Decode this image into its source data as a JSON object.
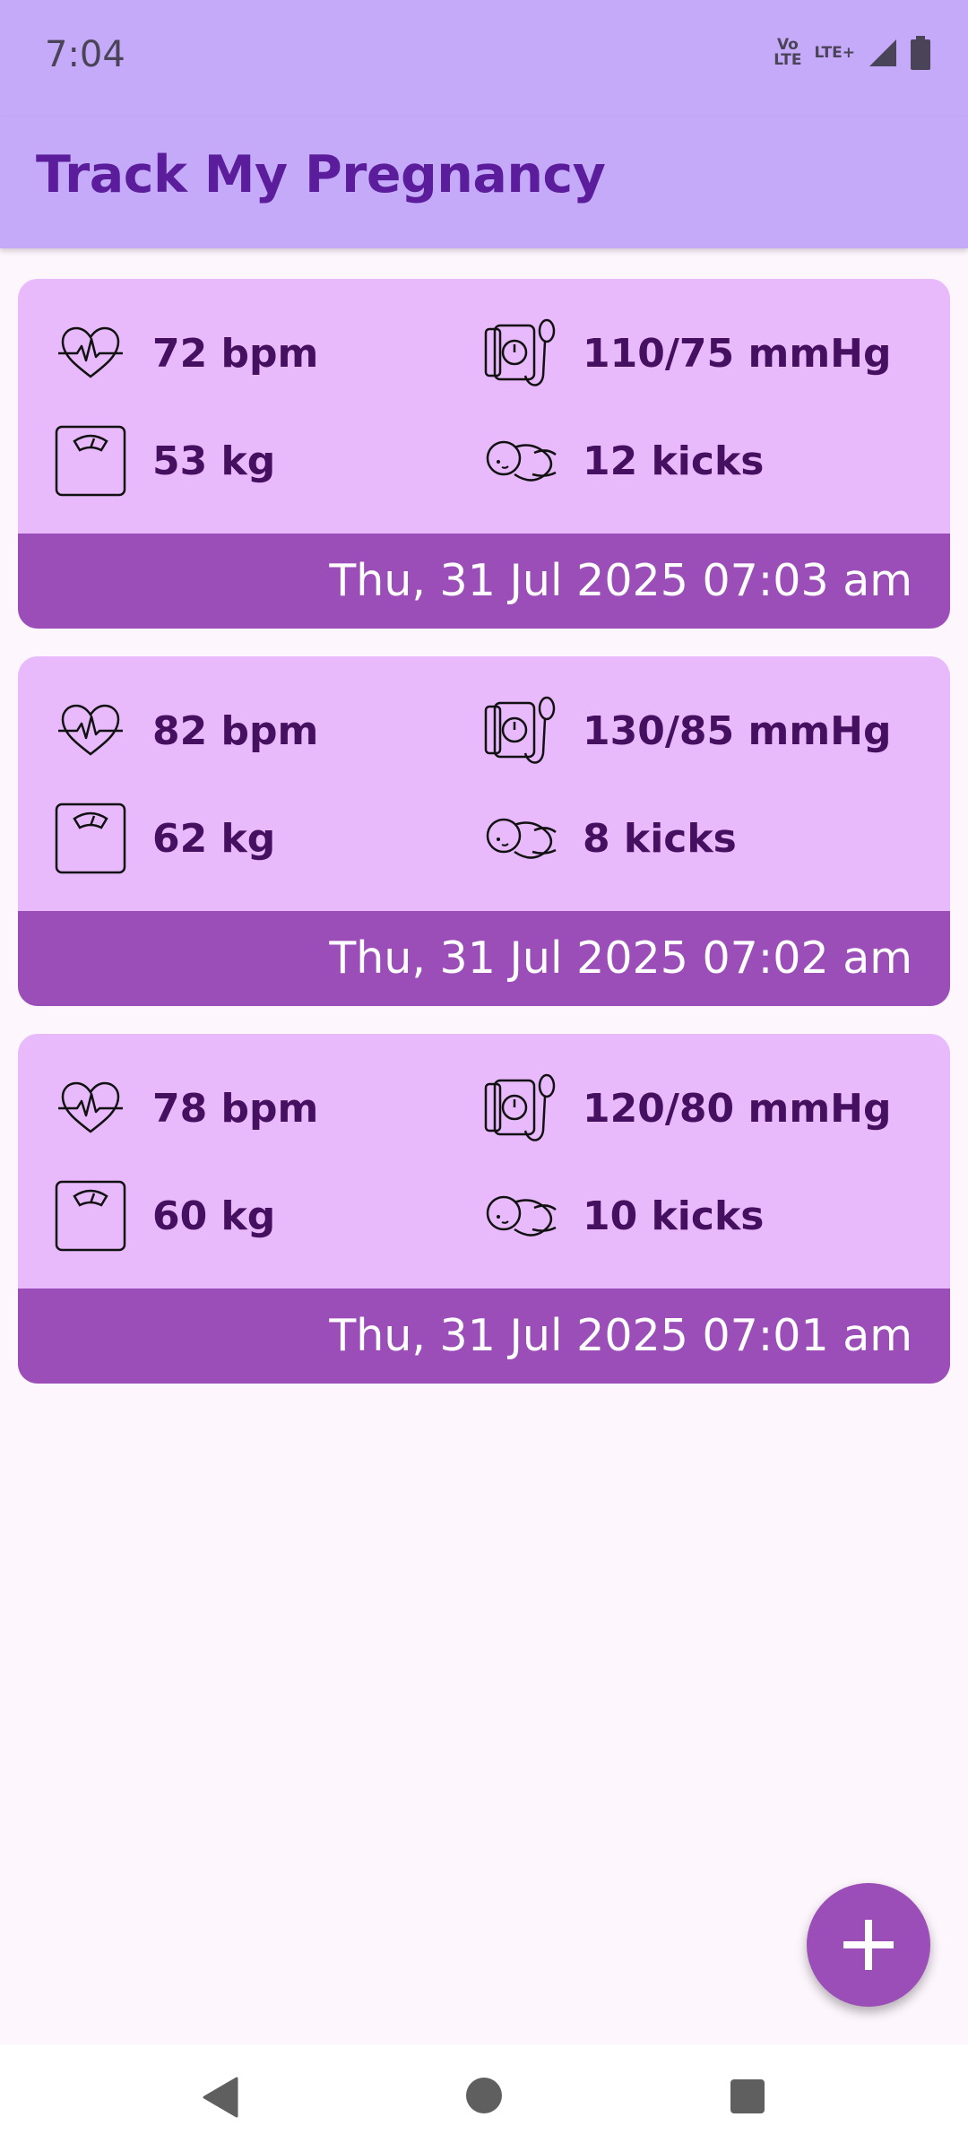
{
  "status": {
    "time": "7:04",
    "net_top": "Vo LTE",
    "lte_label": "LTE+"
  },
  "app": {
    "title": "Track My Pregnancy"
  },
  "entries": [
    {
      "heart_rate": "72 bpm",
      "blood_pressure": "110/75 mmHg",
      "weight": "53 kg",
      "kicks": "12 kicks",
      "date": "Thu, 31 Jul 2025 07:03 am"
    },
    {
      "heart_rate": "82 bpm",
      "blood_pressure": "130/85 mmHg",
      "weight": "62 kg",
      "kicks": "8 kicks",
      "date": "Thu, 31 Jul 2025 07:02 am"
    },
    {
      "heart_rate": "78 bpm",
      "blood_pressure": "120/80 mmHg",
      "weight": "60 kg",
      "kicks": "10 kicks",
      "date": "Thu, 31 Jul 2025 07:01 am"
    }
  ],
  "icons": {
    "heart_rate": "heart-pulse-icon",
    "blood_pressure": "blood-pressure-cuff-icon",
    "weight": "weight-scale-icon",
    "kicks": "baby-icon",
    "fab": "plus-icon",
    "nav_back": "back-triangle-icon",
    "nav_home": "home-circle-icon",
    "nav_recents": "recents-square-icon"
  },
  "colors": {
    "app_bar": "#c5aafa",
    "title": "#5b1d9b",
    "card": "#e8b9fb",
    "card_footer": "#9b4db8",
    "value_text": "#45105f",
    "fab": "#9b4db8",
    "background": "#fdf6fd"
  }
}
